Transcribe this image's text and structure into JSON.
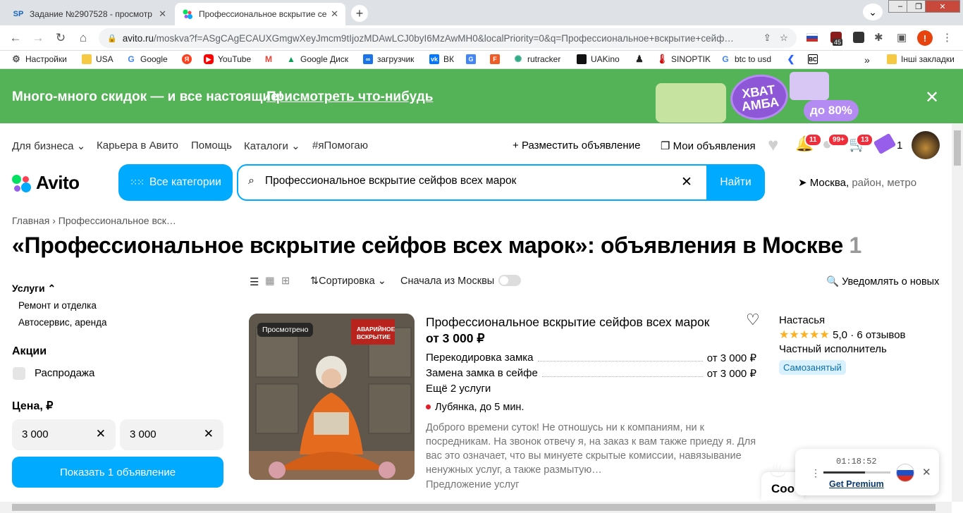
{
  "browser": {
    "tabs": [
      {
        "icon": "SP",
        "title": "Задание №2907528 - просмотр",
        "close": "✕"
      },
      {
        "icon": "avito",
        "title": "Профессиональное вскрытие се",
        "close": "✕"
      }
    ],
    "new_tab": "+",
    "url_host": "avito.ru",
    "url_path": "/moskva?f=ASgCAgECAUXGmgwXeyJmcm9tIjozMDAwLCJ0byI6MzAwMH0&localPriority=0&q=Профессиональное+вскрытие+сейф…",
    "bookmarks": [
      "Настройки",
      "USA",
      "Google",
      "YouTube",
      "Google Диск",
      "загрузчик",
      "ВК",
      "rutracker",
      "UAKino",
      "SINOPTIK",
      "btc to usd"
    ],
    "bookmarks_more": "»",
    "other_bookmarks": "Інші закладки",
    "ext_badge": "45"
  },
  "promo": {
    "text": "Много-много скидок — и все настоящие!",
    "link": "Присмотреть что-нибудь",
    "badge1": "ХВАТ АМБА",
    "badge2": "до 80%",
    "close": "✕"
  },
  "header": {
    "nav": [
      "Для бизнеса",
      "Карьера в Авито",
      "Помощь",
      "Каталоги",
      "#яПомогаю"
    ],
    "post_ad": "Разместить объявление",
    "my_ads": "Мои объявления",
    "bell_badge": "11",
    "chat_badge": "99+",
    "cart_badge": "13",
    "wallet_count": "1",
    "logo": "Avito",
    "all_categories": "Все категории",
    "search_value": "Профессиональное вскрытие сейфов всех марок",
    "find": "Найти",
    "location_city": "Москва,",
    "location_rest": "район, метро"
  },
  "breadcrumb": {
    "home": "Главная",
    "sep": "›",
    "current": "Профессиональное вск…"
  },
  "page_title": "«Профессиональное вскрытие сейфов всех марок»: объявления в Москве",
  "result_count": "1",
  "filters": {
    "services_label": "Услуги",
    "services": [
      "Ремонт и отделка",
      "Автосервис, аренда"
    ],
    "promo_label": "Акции",
    "sale": "Распродажа",
    "price_label": "Цена, ₽",
    "price_from": "3 000",
    "price_to": "3 000",
    "show_button": "Показать 1 объявление"
  },
  "toolbar": {
    "sort": "Сортировка",
    "moscow_first": "Сначала из Москвы",
    "notify": "Уведомлять о новых"
  },
  "listing": {
    "viewed": "Просмотрено",
    "photo_sign": "АВАРИЙНОЕ ВСКРЫТИЕ",
    "title": "Профессиональное вскрытие сейфов всех марок",
    "price": "от 3 000 ₽",
    "services": [
      {
        "name": "Перекодировка замка",
        "price": "от 3 000 ₽"
      },
      {
        "name": "Замена замка в сейфе",
        "price": "от 3 000 ₽"
      }
    ],
    "more_services": "Ещё 2 услуги",
    "metro": "Лубянка, до 5 мин.",
    "description": "Доброго времени суток! Не отношусь ни к компаниям, ни к посредникам. На звонок отвечу я, на заказ к вам также приеду я. Для вас это означает, что вы минуете скрытые комиссии, навязывание ненужных услуг, а также размытую…",
    "kind": "Предложение услуг",
    "seller": "Настасья",
    "stars": "★★★★★",
    "rating": "5,0 · 6 отзывов",
    "seller_type": "Частный исполнитель",
    "badge": "Самозанятый"
  },
  "player": {
    "time": "01:18:52",
    "progress": 0.62,
    "premium": "Get Premium"
  },
  "cookie": "Coo"
}
